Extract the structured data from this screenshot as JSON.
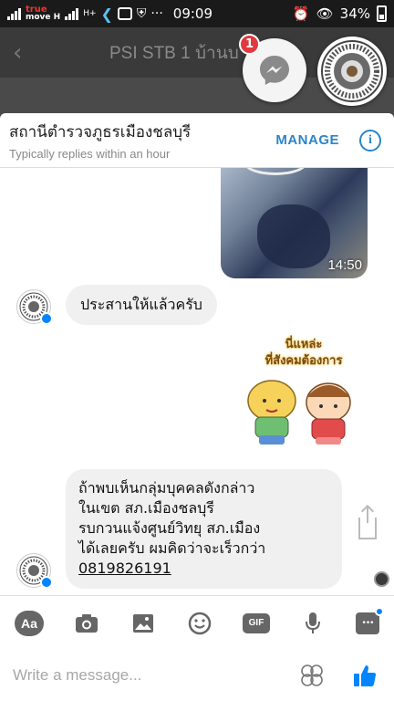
{
  "status_bar": {
    "carrier_line1": "true",
    "carrier_line2": "move H",
    "net2": "H+",
    "time": "09:09",
    "battery": "34%"
  },
  "thread": {
    "back_icon": "back-arrow-icon",
    "title": "PSI STB 1 บ้านบ"
  },
  "chat_heads": {
    "messenger_badge": "1"
  },
  "popover": {
    "page_name": "สถานีตำรวจภูธรเมืองชลบุรี",
    "subtitle": "Typically replies within an hour",
    "manage_label": "MANAGE",
    "info_icon": "info-icon"
  },
  "messages": {
    "video_duration": "14:50",
    "msg1": "ประสานให้แล้วครับ",
    "sticker_caption_line1": "นี่แหล่ะ",
    "sticker_caption_line2": "ที่สังคมต้องการ",
    "msg2_line1": "ถ้าพบเห็นกลุ่มบุคคลดังกล่าว",
    "msg2_line2": "ในเขต สภ.เมืองชลบุรี",
    "msg2_line3": "รบกวนแจ้งศูนย์วิทยุ สภ.เมือง",
    "msg2_line4": "ได้เลยครับ ผมคิดว่าจะเร็วกว่า",
    "msg2_phone": "0819826191"
  },
  "toolbar": {
    "aa_label": "Aa",
    "gif_label": "GIF",
    "more_label": "•••"
  },
  "composer": {
    "placeholder": "Write a message..."
  },
  "colors": {
    "accent": "#2a86c8",
    "messenger_blue": "#0084ff",
    "badge_red": "#e0393e"
  }
}
